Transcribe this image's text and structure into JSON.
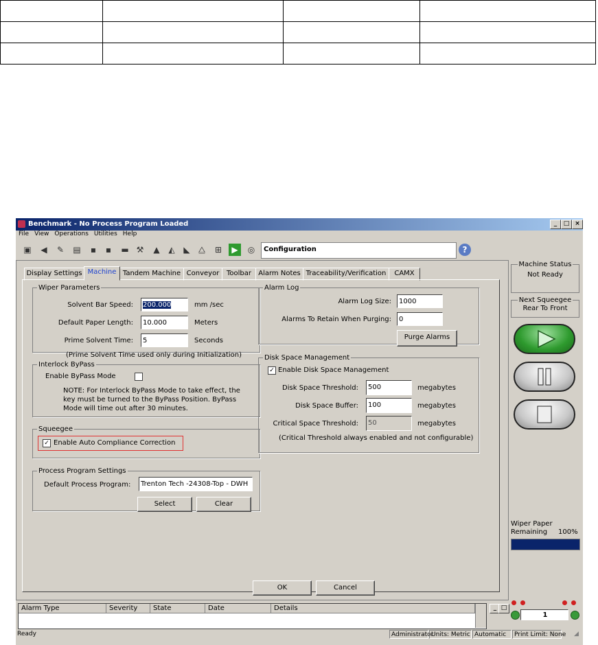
{
  "window": {
    "title": "Benchmark - No Process Program Loaded",
    "menu": [
      "File",
      "View",
      "Operations",
      "Utilities",
      "Help"
    ],
    "toolbar_title": "Configuration"
  },
  "tabs": [
    "Display Settings",
    "Machine",
    "Tandem Machine",
    "Conveyor",
    "Toolbar",
    "Alarm Notes",
    "Traceability/Verification",
    "CAMX"
  ],
  "active_tab": "Machine",
  "wiper": {
    "legend": "Wiper Parameters",
    "solvent_label": "Solvent Bar Speed:",
    "solvent_value": "200.000",
    "solvent_unit": "mm /sec",
    "paper_label": "Default Paper Length:",
    "paper_value": "10.000",
    "paper_unit": "Meters",
    "prime_label": "Prime Solvent Time:",
    "prime_value": "5",
    "prime_unit": "Seconds",
    "note": "(Prime Solvent Time used only during Initialization)"
  },
  "interlock": {
    "legend": "Interlock ByPass",
    "enable_label": "Enable ByPass Mode",
    "note": "NOTE: For Interlock ByPass Mode to take effect, the key must be turned to the ByPass Position. ByPass Mode will time out after 30 minutes."
  },
  "squeegee": {
    "legend": "Squeegee",
    "auto_label": "Enable Auto Compliance Correction"
  },
  "process": {
    "legend": "Process Program Settings",
    "default_label": "Default Process Program:",
    "default_value": "Trenton Tech -24308-Top - DWH",
    "select": "Select",
    "clear": "Clear"
  },
  "alarm_log": {
    "legend": "Alarm Log",
    "size_label": "Alarm Log Size:",
    "size_value": "1000",
    "retain_label": "Alarms To Retain When Purging:",
    "retain_value": "0",
    "purge": "Purge Alarms"
  },
  "disk": {
    "legend": "Disk Space Management",
    "enable_label": "Enable Disk Space Management",
    "threshold_label": "Disk Space Threshold:",
    "threshold_value": "500",
    "buffer_label": "Disk Space Buffer:",
    "buffer_value": "100",
    "critical_label": "Critical Space Threshold:",
    "critical_value": "50",
    "unit": "megabytes",
    "note": "(Critical Threshold always enabled and not configurable)"
  },
  "dialog": {
    "ok": "OK",
    "cancel": "Cancel"
  },
  "right": {
    "status_title": "Machine Status",
    "status_value": "Not Ready",
    "squeegee_title": "Next Squeegee",
    "squeegee_value": "Rear To Front",
    "wiper_label": "Wiper Paper",
    "remaining_label": "Remaining",
    "remaining_pct": "100%",
    "wiper_fraction": 1.0,
    "counter": "1"
  },
  "alarm_columns": [
    "Alarm Type",
    "Severity",
    "State",
    "Date",
    "Details"
  ],
  "status": {
    "ready": "Ready",
    "user": "Administrator",
    "units": "Units: Metric",
    "mode": "Automatic",
    "print_limit": "Print Limit: None"
  },
  "colors": {
    "run_green": "#2e9a2e",
    "highlight_red": "#e03030",
    "wiper_bar": "#0a246a"
  }
}
